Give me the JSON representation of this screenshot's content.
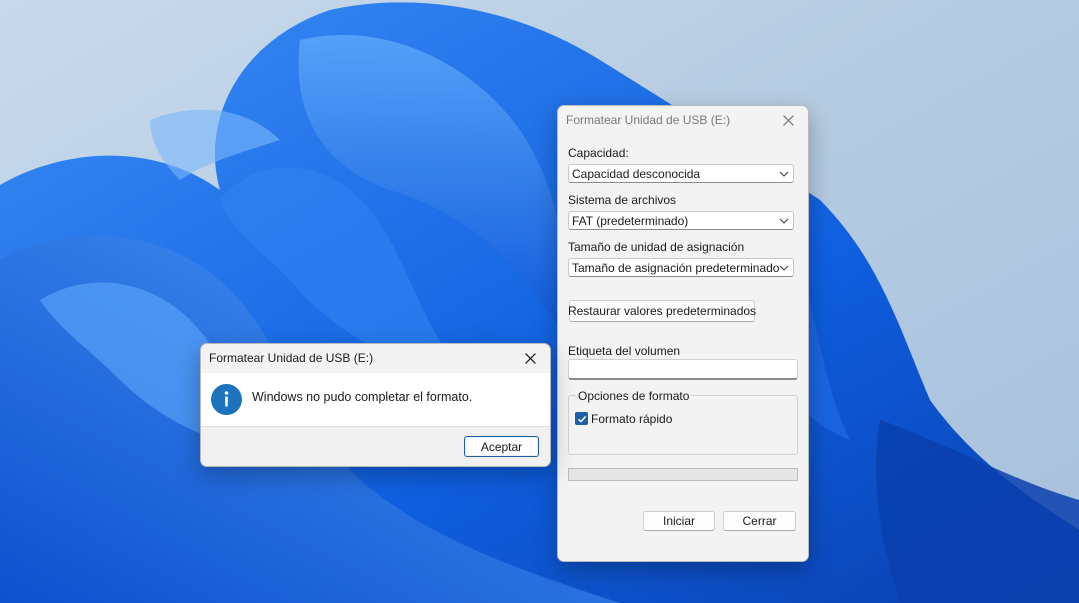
{
  "desktop": {
    "wallpaper": "windows-11-bloom"
  },
  "format_dialog": {
    "title": "Formatear Unidad de USB (E:)",
    "capacity_label": "Capacidad:",
    "capacity_value": "Capacidad desconocida",
    "filesystem_label": "Sistema de archivos",
    "filesystem_value": "FAT (predeterminado)",
    "allocation_label": "Tamaño de unidad de asignación",
    "allocation_value": "Tamaño de asignación predeterminado",
    "restore_defaults_button": "Restaurar valores predeterminados",
    "volume_label": "Etiqueta del volumen",
    "volume_value": "",
    "format_options_title": "Opciones de formato",
    "quick_format_label": "Formato rápido",
    "quick_format_checked": true,
    "progress": 0,
    "start_button": "Iniciar",
    "close_button": "Cerrar"
  },
  "message_box": {
    "title": "Formatear Unidad de USB (E:)",
    "icon": "info-icon",
    "message": "Windows no pudo completar el formato.",
    "ok_button": "Aceptar"
  },
  "colors": {
    "accent": "#1e5fa8",
    "info_icon": "#1e73be",
    "window_bg": "#f3f3f3"
  }
}
